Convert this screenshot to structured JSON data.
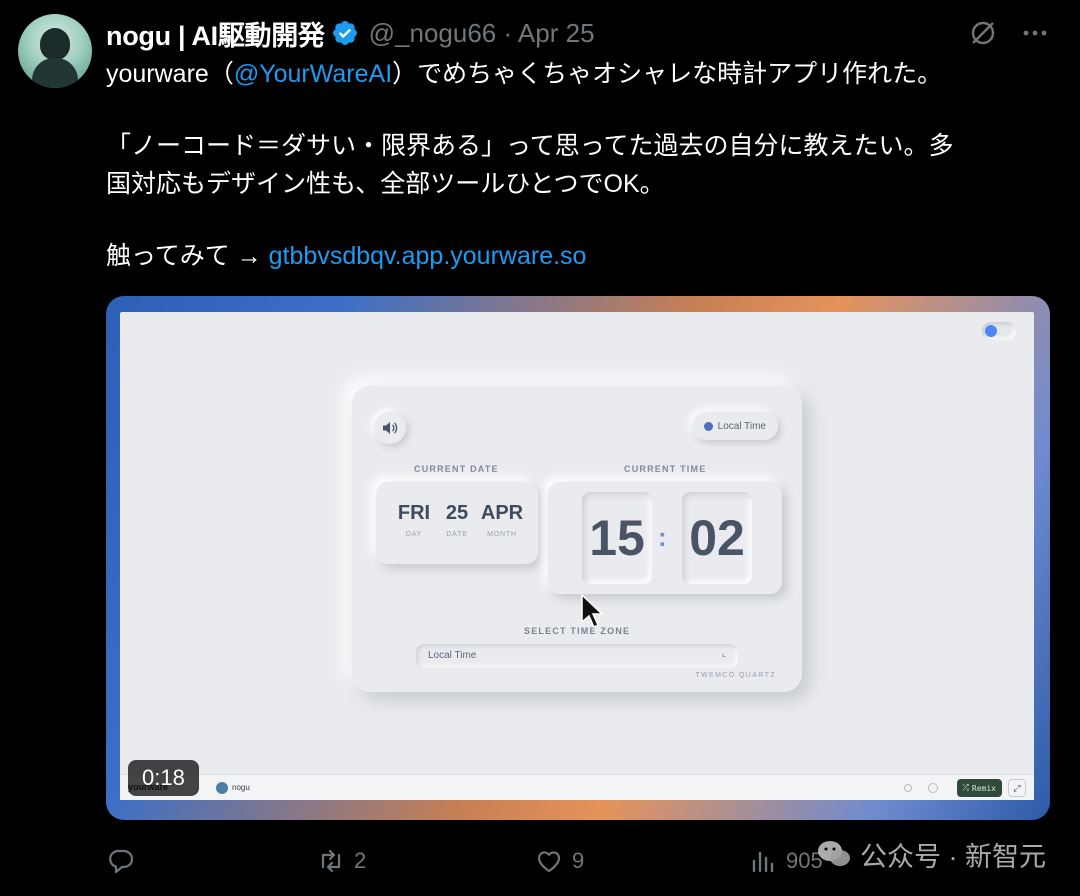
{
  "tweet": {
    "author_name": "nogu | AI駆動開発",
    "handle_date": "@_nogu66 · Apr 25",
    "line1_prefix": "yourware（",
    "line1_mention": "@YourWareAI",
    "line1_suffix": "）でめちゃくちゃオシャレな時計アプリ作れた。",
    "line2": "「ノーコード＝ダサい・限界ある」って思ってた過去の自分に教えたい。多",
    "line3": "国対応もデザイン性も、全部ツールひとつでOK。",
    "line4_prefix": "触ってみて → ",
    "line4_link": "gtbbvsdbqv.app.yourware.so"
  },
  "video": {
    "duration": "0:18",
    "app": {
      "tz_badge": "Local Time",
      "current_date_label": "CURRENT DATE",
      "current_time_label": "CURRENT TIME",
      "day": "FRI",
      "day_sub": "DAY",
      "date": "25",
      "date_sub": "DATE",
      "month": "APR",
      "month_sub": "MONTH",
      "hours": "15",
      "colon": ":",
      "minutes": "02",
      "select_label": "SELECT TIME ZONE",
      "select_value": "Local Time",
      "select_chevron": "⌞",
      "brand": "TWEMCO QUARTZ"
    },
    "bottom_bar": {
      "logo": "yourware",
      "user": "nogu",
      "remix": "Remix",
      "expand": "⤢"
    }
  },
  "actions": {
    "replies": "",
    "reposts": "2",
    "likes": "9",
    "views": "905"
  },
  "watermark": "公众号 · 新智元",
  "colors": {
    "background": "#000000",
    "link": "#1d9bf0",
    "verified": "#1d9bf0",
    "muted": "#71767b",
    "accent": "#4f86f7"
  }
}
